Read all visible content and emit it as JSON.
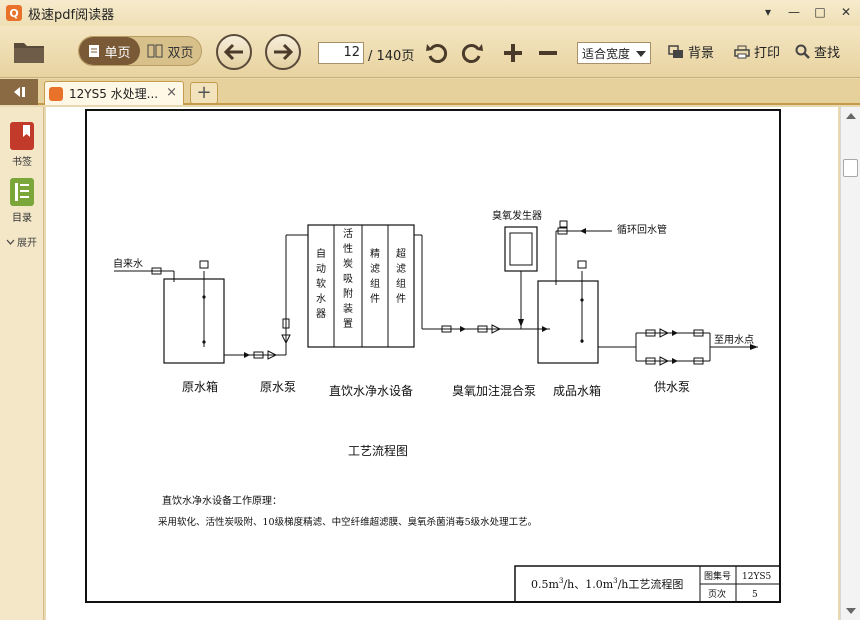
{
  "app": {
    "title": "极速pdf阅读器",
    "logo_glyph": "Q",
    "accent": "#e8722a"
  },
  "window": {
    "minimize": "—",
    "maximize": "□",
    "close": "✕",
    "menu": "▾"
  },
  "toolbar": {
    "single_page": "单页",
    "double_page": "双页",
    "current_page": "12",
    "total_pages": "/ 140页",
    "zoom": "适合宽度",
    "background": "背景",
    "print": "打印",
    "find": "查找"
  },
  "tabs": [
    {
      "title": "12YS5 水处理...",
      "close": "×"
    }
  ],
  "new_tab": "+",
  "sidebar": {
    "bookmarks": "书签",
    "contents": "目录",
    "expand": "展开"
  },
  "document": {
    "labels": {
      "tap_water": "自来水",
      "raw_tank": "原水箱",
      "raw_pump": "原水泵",
      "equipment": "直饮水净水设备",
      "ozone_pump": "臭氧加注混合泵",
      "product_tank": "成品水箱",
      "supply_pump": "供水泵",
      "ozone_gen": "臭氧发生器",
      "return_pipe": "循环回水管",
      "to_point": "至用水点",
      "diagram_title": "工艺流程图"
    },
    "columns": [
      [
        "自",
        "动",
        "软",
        "水",
        "器"
      ],
      [
        "活",
        "性",
        "炭",
        "吸",
        "附",
        "装",
        "置"
      ],
      [
        "精",
        "滤",
        "组",
        "件"
      ],
      [
        "超",
        "滤",
        "组",
        "件"
      ]
    ],
    "principle_title": "直饮水净水设备工作原理：",
    "principle_text": "采用软化、活性炭吸附、10级梯度精滤、中空纤维超滤膜、臭氧杀菌消毒5级水处理工艺。",
    "title_block": {
      "main_a": "0.5m",
      "main_b": "/h、1.0m",
      "main_c": "/h工艺流程图",
      "sup": "3",
      "atlas_label": "图集号",
      "atlas_value": "12YS5",
      "page_label": "页次",
      "page_value": "5"
    }
  }
}
